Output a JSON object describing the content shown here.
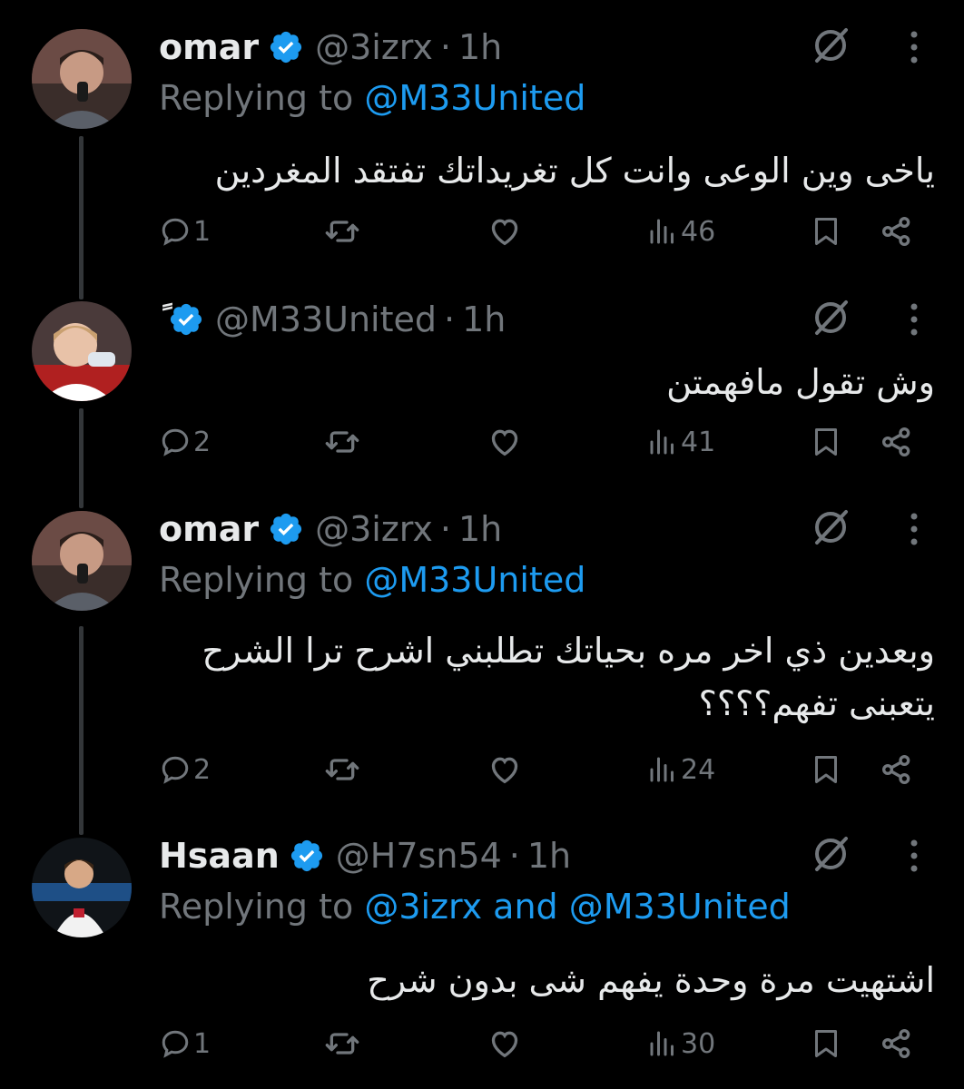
{
  "colors": {
    "background": "#000000",
    "text": "#e7e9ea",
    "muted": "#71767b",
    "link": "#1d9bf0",
    "verified": "#1d9bf0",
    "thread_line": "#333639"
  },
  "icons": {
    "verified": "verified-badge-icon",
    "grok": "grok-icon",
    "more": "more-vertical-icon",
    "reply": "reply-icon",
    "retweet": "retweet-icon",
    "like": "like-icon",
    "views": "views-icon",
    "bookmark": "bookmark-icon",
    "share": "share-icon"
  },
  "tweets": [
    {
      "name": "omar",
      "handle": "@3izrx",
      "dot": "·",
      "time": "1h",
      "replying_prefix": "Replying to",
      "replying_links": "@M33United",
      "text": "ياخى وين الوعى وانت كل تغريداتك تفتقد المغردين",
      "replies": "1",
      "retweets": "",
      "likes": "",
      "views": "46"
    },
    {
      "name": "ً",
      "handle": "@M33United",
      "dot": "·",
      "time": "1h",
      "text": "وش تقول مافهمتن",
      "replies": "2",
      "retweets": "",
      "likes": "",
      "views": "41"
    },
    {
      "name": "omar",
      "handle": "@3izrx",
      "dot": "·",
      "time": "1h",
      "replying_prefix": "Replying to",
      "replying_links": "@M33United",
      "text": "وبعدين ذي اخر مره بحياتك تطلبني اشرح ترا الشرح يتعبنى تفهم؟؟؟؟",
      "replies": "2",
      "retweets": "",
      "likes": "",
      "views": "24"
    },
    {
      "name": "Hsaan",
      "handle": "@H7sn54",
      "dot": "·",
      "time": "1h",
      "replying_prefix": "Replying to",
      "replying_links": "@3izrx and @M33United",
      "text": "اشتهيت مرة وحدة يفهم شى بدون شرح",
      "replies": "1",
      "retweets": "",
      "likes": "",
      "views": "30"
    }
  ]
}
